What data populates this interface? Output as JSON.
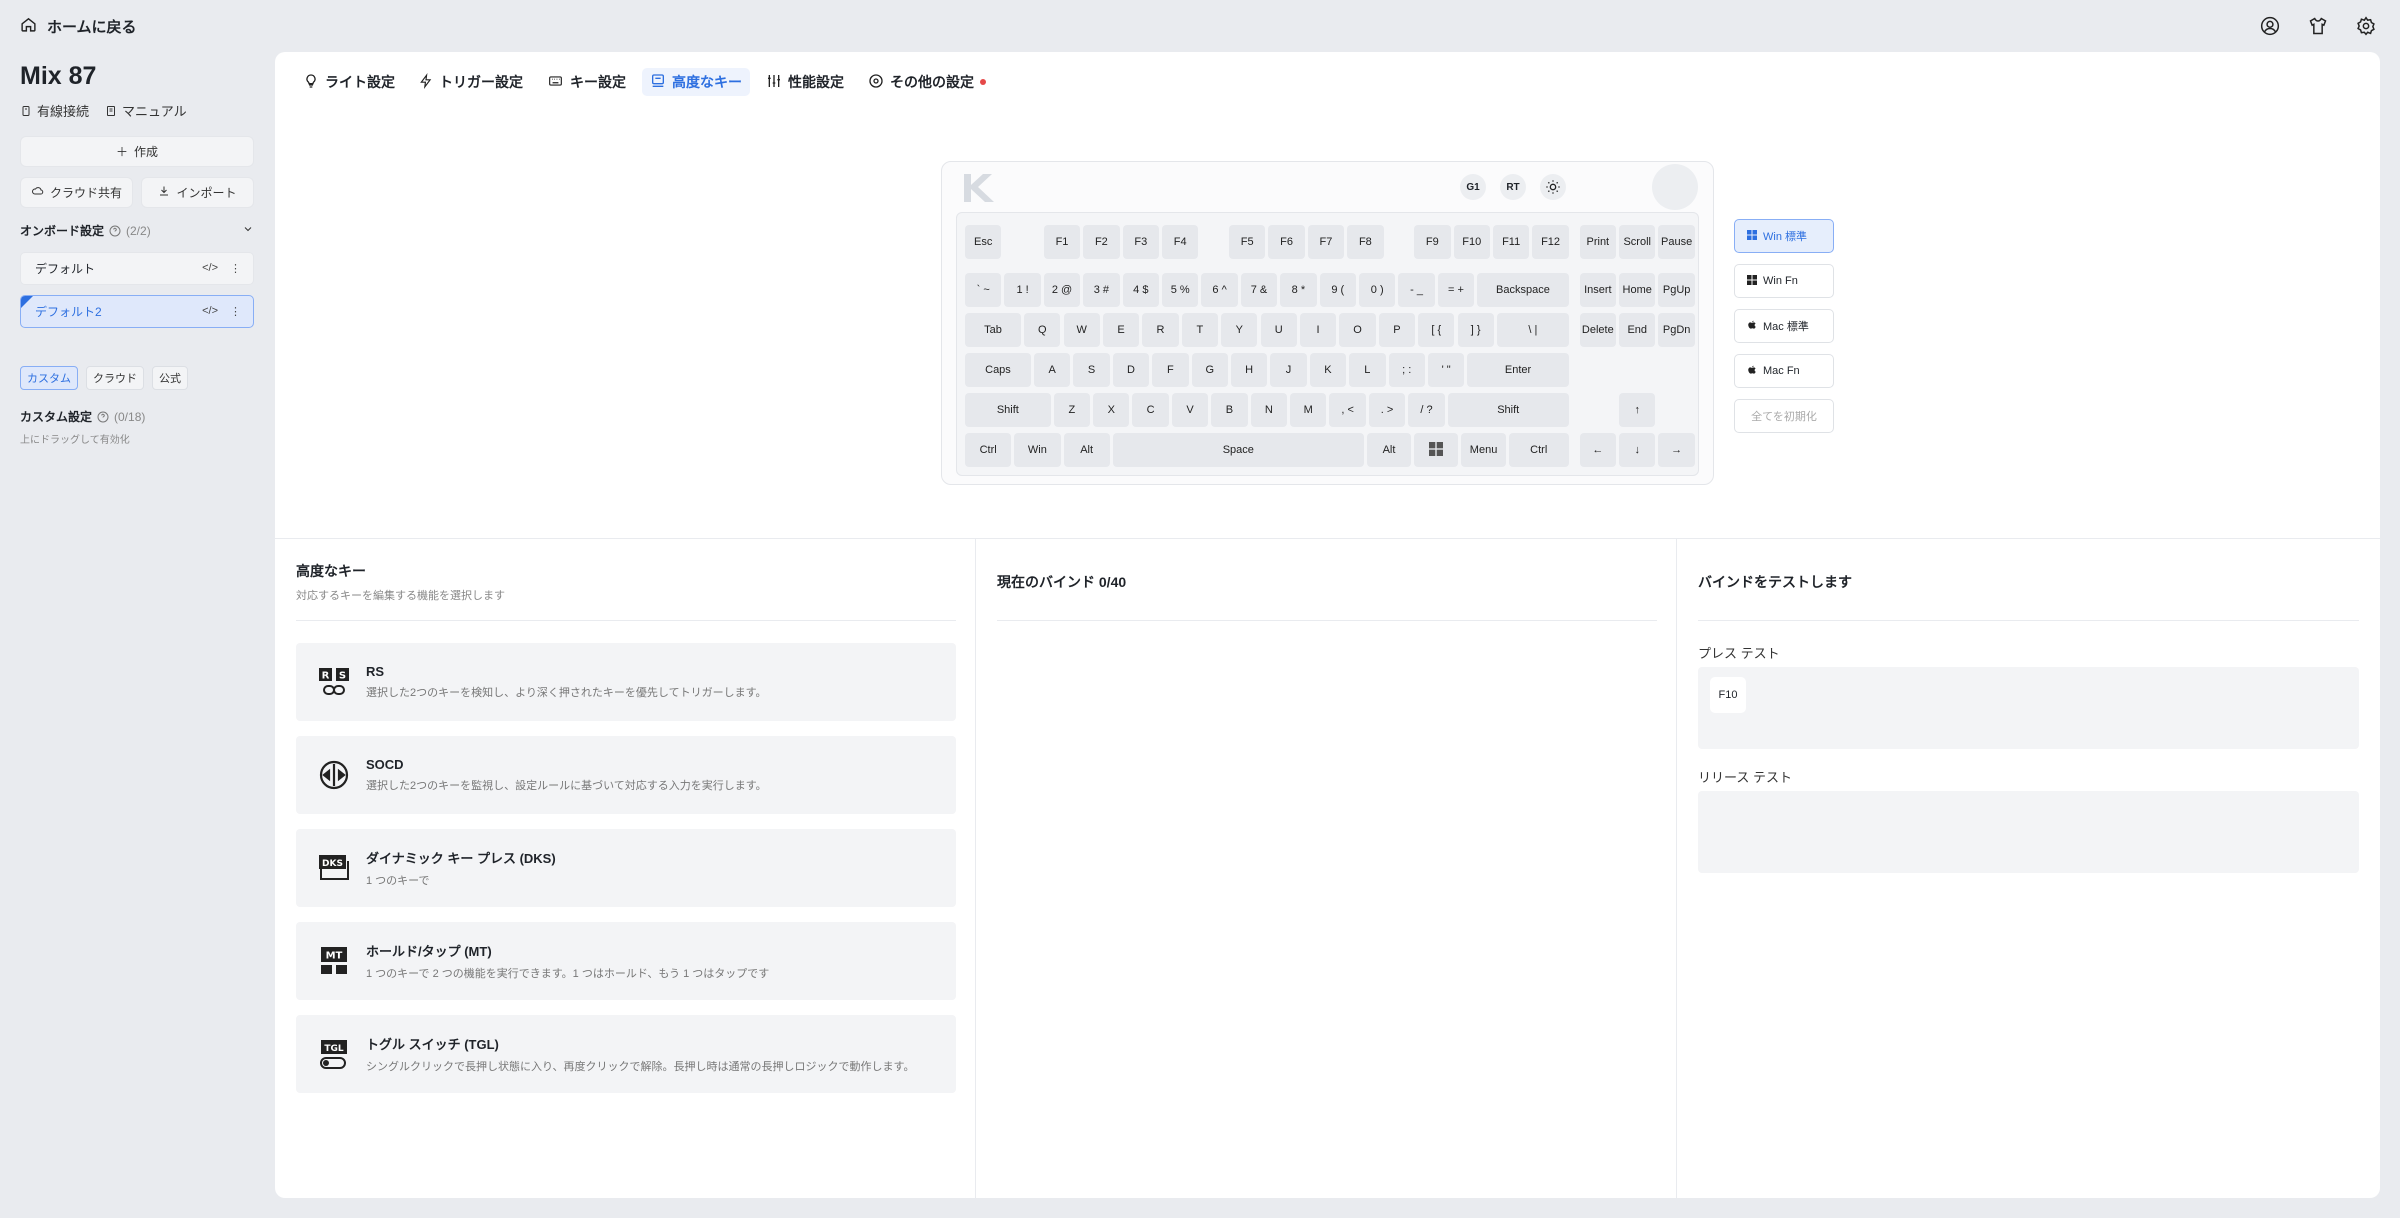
{
  "nav": {
    "back_label": "ホームに戻る"
  },
  "sidebar": {
    "device_name": "Mix 87",
    "connection": "有線接続",
    "manual": "マニュアル",
    "create": "作成",
    "cloud_share": "クラウド共有",
    "import": "インポート",
    "onboard_title": "オンボード設定",
    "onboard_count": "(2/2)",
    "profiles": [
      {
        "name": "デフォルト",
        "active": false
      },
      {
        "name": "デフォルト2",
        "active": true
      }
    ],
    "tags": [
      "カスタム",
      "クラウド",
      "公式"
    ],
    "custom_title": "カスタム設定",
    "custom_count": "(0/18)",
    "drag_hint": "上にドラッグして有効化"
  },
  "tabs": [
    {
      "label": "ライト設定",
      "icon": "light-bulb-icon"
    },
    {
      "label": "トリガー設定",
      "icon": "lightning-icon"
    },
    {
      "label": "キー設定",
      "icon": "keyboard-icon"
    },
    {
      "label": "高度なキー",
      "icon": "advanced-key-icon",
      "active": true
    },
    {
      "label": "性能設定",
      "icon": "sliders-icon"
    },
    {
      "label": "その他の設定",
      "icon": "gear-icon",
      "badge": true
    }
  ],
  "keyboard": {
    "controls": [
      "G1",
      "RT"
    ],
    "keys": [
      [
        "Esc",
        "F1",
        "F2",
        "F3",
        "F4",
        "F5",
        "F6",
        "F7",
        "F8",
        "F9",
        "F10",
        "F11",
        "F12",
        "Print",
        "Scroll",
        "Pause"
      ],
      [
        "` ~",
        "1 !",
        "2 @",
        "3 #",
        "4 $",
        "5 %",
        "6 ^",
        "7 &",
        "8 *",
        "9 (",
        "0 )",
        "- _",
        "= +",
        "Backspace",
        "Insert",
        "Home",
        "PgUp"
      ],
      [
        "Tab",
        "Q",
        "W",
        "E",
        "R",
        "T",
        "Y",
        "U",
        "I",
        "O",
        "P",
        "[ {",
        "] }",
        "\\ |",
        "Delete",
        "End",
        "PgDn"
      ],
      [
        "Caps",
        "A",
        "S",
        "D",
        "F",
        "G",
        "H",
        "J",
        "K",
        "L",
        "; :",
        "' \"",
        "Enter"
      ],
      [
        "Shift",
        "Z",
        "X",
        "C",
        "V",
        "B",
        "N",
        "M",
        ", <",
        ". >",
        "/ ?",
        "Shift",
        "↑"
      ],
      [
        "Ctrl",
        "Win",
        "Alt",
        "Space",
        "Alt",
        "",
        "Menu",
        "Ctrl",
        "←",
        "↓",
        "→"
      ]
    ]
  },
  "layers": [
    "Win 標準",
    "Win Fn",
    "Mac 標準",
    "Mac Fn"
  ],
  "reset_label": "全てを初期化",
  "advanced": {
    "title": "高度なキー",
    "subtitle": "対応するキーを編集する機能を選択します",
    "items": [
      {
        "icon": "rs-icon",
        "title": "RS",
        "desc": "選択した2つのキーを検知し、より深く押されたキーを優先してトリガーします。"
      },
      {
        "icon": "socd-icon",
        "title": "SOCD",
        "desc": "選択した2つのキーを監視し、設定ルールに基づいて対応する入力を実行します。"
      },
      {
        "icon": "dks-icon",
        "title": "ダイナミック キー プレス (DKS)",
        "desc": "1 つのキーで"
      },
      {
        "icon": "mt-icon",
        "title": "ホールド/タップ (MT)",
        "desc": "1 つのキーで 2 つの機能を実行できます。1 つはホールド、もう 1 つはタップです"
      },
      {
        "icon": "tgl-icon",
        "title": "トグル スイッチ (TGL)",
        "desc": "シングルクリックで長押し状態に入り、再度クリックで解除。長押し時は通常の長押しロジックで動作します。"
      }
    ]
  },
  "binds": {
    "title": "現在のバインド 0/40"
  },
  "test": {
    "title": "バインドをテストします",
    "press_label": "プレス テスト",
    "press_key": "F10",
    "release_label": "リリース テスト"
  }
}
